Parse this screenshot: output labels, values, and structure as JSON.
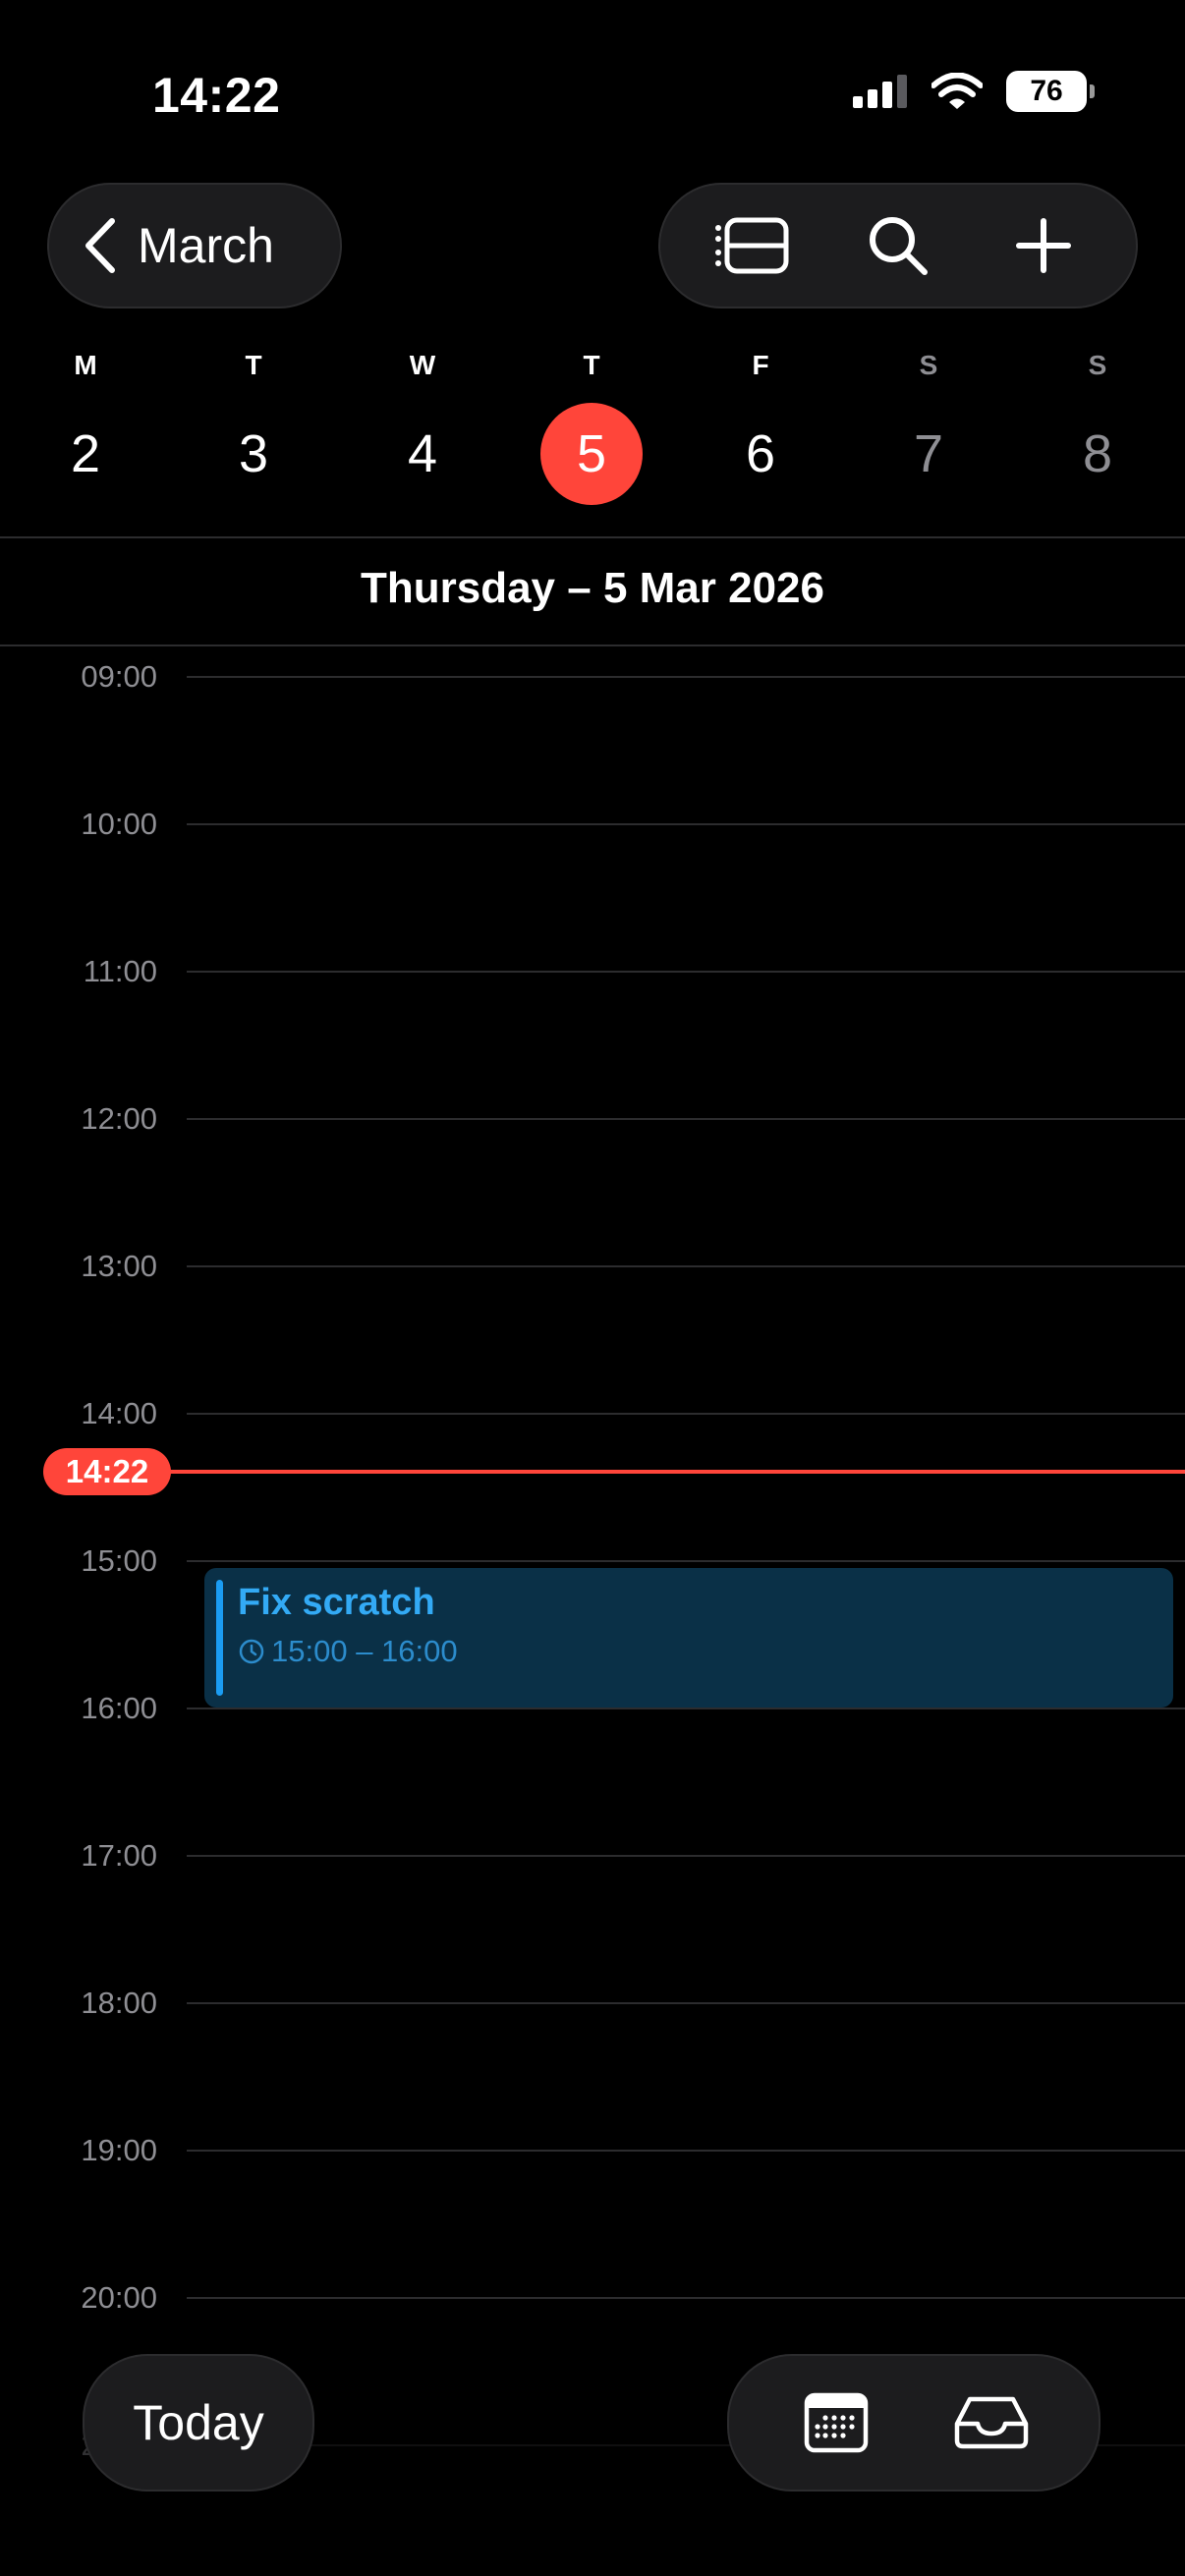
{
  "status": {
    "time": "14:22",
    "battery": "76"
  },
  "header": {
    "back_label": "March"
  },
  "week": [
    {
      "dow": "M",
      "num": "2"
    },
    {
      "dow": "T",
      "num": "3"
    },
    {
      "dow": "W",
      "num": "4"
    },
    {
      "dow": "T",
      "num": "5"
    },
    {
      "dow": "F",
      "num": "6"
    },
    {
      "dow": "S",
      "num": "7"
    },
    {
      "dow": "S",
      "num": "8"
    }
  ],
  "selected_day_index": 3,
  "date_title": "Thursday – 5 Mar 2026",
  "hours": [
    "09:00",
    "10:00",
    "11:00",
    "12:00",
    "13:00",
    "14:00",
    "15:00",
    "16:00",
    "17:00",
    "18:00",
    "19:00",
    "20:00",
    "21:00"
  ],
  "now_label": "14:22",
  "event": {
    "title": "Fix scratch",
    "time": "15:00 – 16:00",
    "color": "#1b9cf2"
  },
  "footer": {
    "today_label": "Today"
  },
  "colors": {
    "accent": "#ff453a",
    "background": "#000000"
  }
}
